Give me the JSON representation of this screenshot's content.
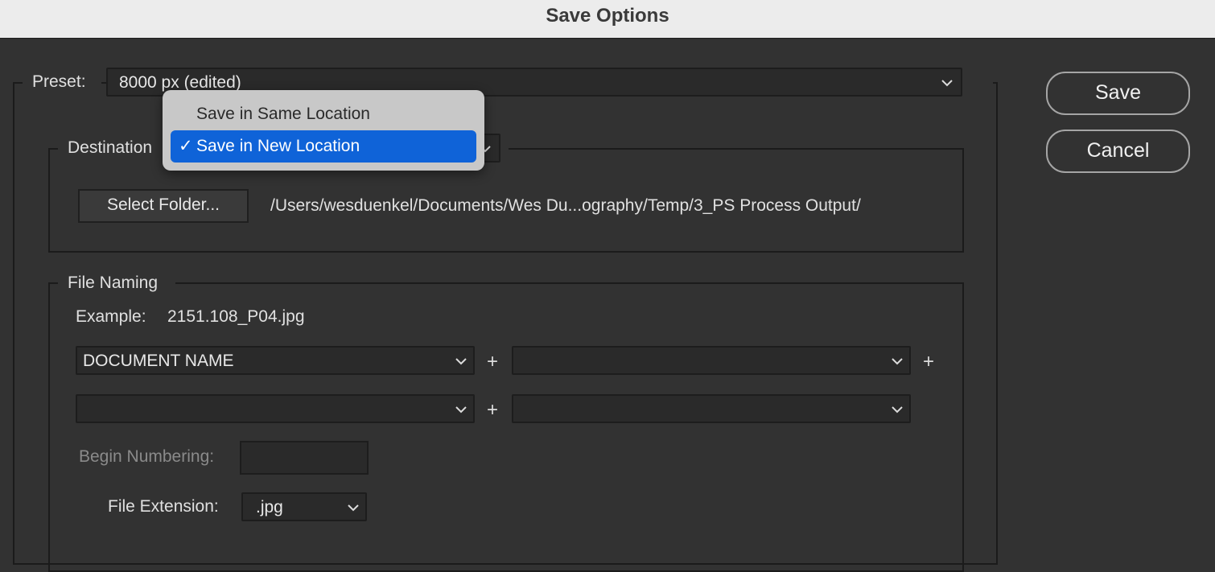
{
  "window": {
    "title": "Save Options"
  },
  "preset": {
    "label": "Preset:",
    "value": "8000 px (edited)"
  },
  "destination": {
    "label": "Destination",
    "select_folder_label": "Select Folder...",
    "path": "/Users/wesduenkel/Documents/Wes Du...ography/Temp/3_PS Process Output/",
    "menu": [
      {
        "label": "Save in Same Location",
        "selected": false
      },
      {
        "label": "Save in New Location",
        "selected": true
      }
    ],
    "checkmark": "✓"
  },
  "file_naming": {
    "label": "File Naming",
    "example_label": "Example:",
    "example_value": "2151.108_P04.jpg",
    "fields": [
      "DOCUMENT NAME",
      "",
      "",
      ""
    ],
    "plus": "+",
    "begin_numbering_label": "Begin Numbering:",
    "begin_numbering_value": "",
    "file_extension_label": "File Extension:",
    "file_extension_value": ".jpg"
  },
  "buttons": {
    "save": "Save",
    "cancel": "Cancel"
  }
}
